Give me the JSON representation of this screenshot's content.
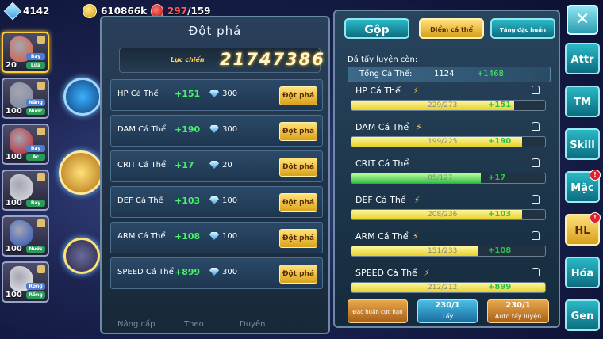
{
  "topbar": {
    "gems": "4142",
    "gold": "610866k",
    "stamina": "297",
    "stamina_max": "/159"
  },
  "team": [
    {
      "level": "20",
      "type1": "Bay",
      "type2": "Lửa",
      "color": "#e0583a",
      "selected": true
    },
    {
      "level": "100",
      "type1": "Năng",
      "type2": "Nước",
      "color": "#7a8aa0"
    },
    {
      "level": "100",
      "type1": "Bay",
      "type2": "Ác",
      "color": "#c0202a"
    },
    {
      "level": "100",
      "type1": "",
      "type2": "Bay",
      "color": "#dde0e6"
    },
    {
      "level": "100",
      "type1": "",
      "type2": "Nước",
      "color": "#2a58c0"
    },
    {
      "level": "100",
      "type1": "Rồng",
      "type2": "Rồng",
      "color": "#f0f0f4"
    }
  ],
  "left_panel": {
    "title": "Đột phá",
    "power_label": "Lực chiến",
    "power_value": "21747386",
    "rows": [
      {
        "name": "HP Cá Thể",
        "plus": "+151",
        "cost": "300",
        "button": "Đột phá"
      },
      {
        "name": "DAM Cá Thể",
        "plus": "+190",
        "cost": "300",
        "button": "Đột phá"
      },
      {
        "name": "CRIT Cá Thể",
        "plus": "+17",
        "cost": "20",
        "button": "Đột phá"
      },
      {
        "name": "DEF Cá Thể",
        "plus": "+103",
        "cost": "100",
        "button": "Đột phá"
      },
      {
        "name": "ARM Cá Thể",
        "plus": "+108",
        "cost": "100",
        "button": "Đột phá"
      },
      {
        "name": "SPEED Cá Thể",
        "plus": "+899",
        "cost": "300",
        "button": "Đột phá"
      }
    ],
    "bottom": [
      "Nâng cấp",
      "Theo",
      "Duyên"
    ]
  },
  "right_panel": {
    "tabs": [
      "Gộp",
      "Điểm cá thể",
      "Tăng đặc huấn"
    ],
    "remain_label": "Đá tẩy luyện còn:",
    "total_label": "Tổng Cá Thể:",
    "total_value": "1124",
    "total_plus": "+1468",
    "stats": [
      {
        "name": "HP Cá Thể",
        "value": "229/273",
        "plus": "+151",
        "fill": 0.84,
        "bolt": true,
        "color": "y"
      },
      {
        "name": "DAM Cá Thể",
        "value": "199/225",
        "plus": "+190",
        "fill": 0.88,
        "bolt": true,
        "color": "y"
      },
      {
        "name": "CRIT Cá Thể",
        "value": "85/127",
        "plus": "+17",
        "fill": 0.67,
        "bolt": false,
        "color": "g"
      },
      {
        "name": "DEF Cá Thể",
        "value": "208/236",
        "plus": "+103",
        "fill": 0.88,
        "bolt": true,
        "color": "y"
      },
      {
        "name": "ARM Cá Thể",
        "value": "151/233",
        "plus": "+108",
        "fill": 0.65,
        "bolt": true,
        "color": "y"
      },
      {
        "name": "SPEED Cá Thể",
        "value": "212/212",
        "plus": "+899",
        "fill": 1.0,
        "bolt": true,
        "color": "y"
      }
    ],
    "buttons": {
      "dac_huan": "Đặc huấn cực hạn",
      "tay_count": "230/1",
      "tay_label": "Tẩy",
      "auto_count": "230/1",
      "auto_label": "Auto tẩy luyện"
    }
  },
  "side_buttons": [
    {
      "label": "Attr",
      "badge": false
    },
    {
      "label": "TM",
      "badge": false
    },
    {
      "label": "Skill",
      "badge": false
    },
    {
      "label": "Mặc",
      "badge": true
    },
    {
      "label": "HL",
      "badge": true,
      "active": true
    },
    {
      "label": "Hóa",
      "badge": false
    },
    {
      "label": "Gen",
      "badge": false
    }
  ],
  "badge_mark": "!",
  "close_label": "✕"
}
